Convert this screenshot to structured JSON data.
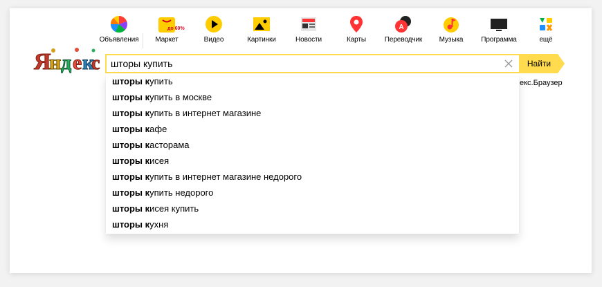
{
  "services": [
    {
      "label": "Объявления",
      "icon": "classifieds-icon"
    },
    {
      "label": "Маркет",
      "icon": "market-icon",
      "badge": "до 60%"
    },
    {
      "label": "Видео",
      "icon": "video-play-icon"
    },
    {
      "label": "Картинки",
      "icon": "images-icon"
    },
    {
      "label": "Новости",
      "icon": "news-icon"
    },
    {
      "label": "Карты",
      "icon": "maps-pin-icon"
    },
    {
      "label": "Переводчик",
      "icon": "translator-icon"
    },
    {
      "label": "Музыка",
      "icon": "music-icon"
    },
    {
      "label": "Программа",
      "icon": "tv-program-icon"
    },
    {
      "label": "ещё",
      "icon": "more-services-icon"
    }
  ],
  "logo": {
    "text": "Яндекс"
  },
  "search": {
    "value": "шторы купить",
    "button_label": "Найти",
    "accent": "#ffdb4d"
  },
  "browser_link": "екс.Браузер",
  "suggestions": [
    {
      "bold": "шторы к",
      "rest": "упить"
    },
    {
      "bold": "шторы к",
      "rest": "упить в москве"
    },
    {
      "bold": "шторы к",
      "rest": "упить в интернет магазине"
    },
    {
      "bold": "шторы к",
      "rest": "афе"
    },
    {
      "bold": "шторы к",
      "rest": "асторама"
    },
    {
      "bold": "шторы к",
      "rest": "исея"
    },
    {
      "bold": "шторы к",
      "rest": "упить в интернет магазине недорого"
    },
    {
      "bold": "шторы к",
      "rest": "упить недорого"
    },
    {
      "bold": "шторы к",
      "rest": "исея купить"
    },
    {
      "bold": "шторы к",
      "rest": "ухня"
    }
  ]
}
